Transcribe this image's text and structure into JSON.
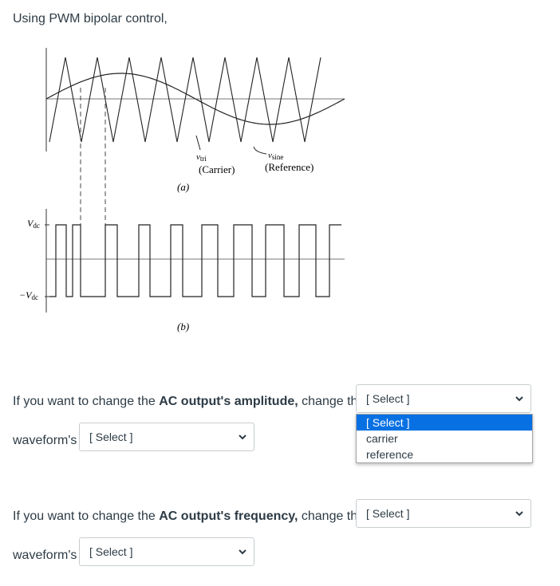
{
  "intro": "Using PWM bipolar control,",
  "figure": {
    "label_vtri": "v",
    "label_vtri_sub": "tri",
    "label_carrier": "(Carrier)",
    "label_vsine": "v",
    "label_vsine_sub": "sine",
    "label_reference": "(Reference)",
    "label_a": "(a)",
    "label_b": "(b)",
    "label_vdc": "V",
    "label_vdc_sub": "dc",
    "label_neg_vdc": "−V",
    "label_neg_vdc_sub": "dc"
  },
  "q1": {
    "prefix": "If you want to change the ",
    "bold": "AC output's amplitude,",
    "suffix": " change the",
    "select1_value": "[ Select ]",
    "waveforms_label": "waveform's",
    "select2_value": "[ Select ]"
  },
  "dropdown": {
    "options": [
      "[ Select ]",
      "carrier",
      "reference"
    ]
  },
  "q2": {
    "prefix": "If you want to change the ",
    "bold": "AC output's frequency,",
    "suffix": " change the",
    "select1_value": "[ Select ]",
    "waveforms_label": "waveform's",
    "select2_value": "[ Select ]"
  }
}
